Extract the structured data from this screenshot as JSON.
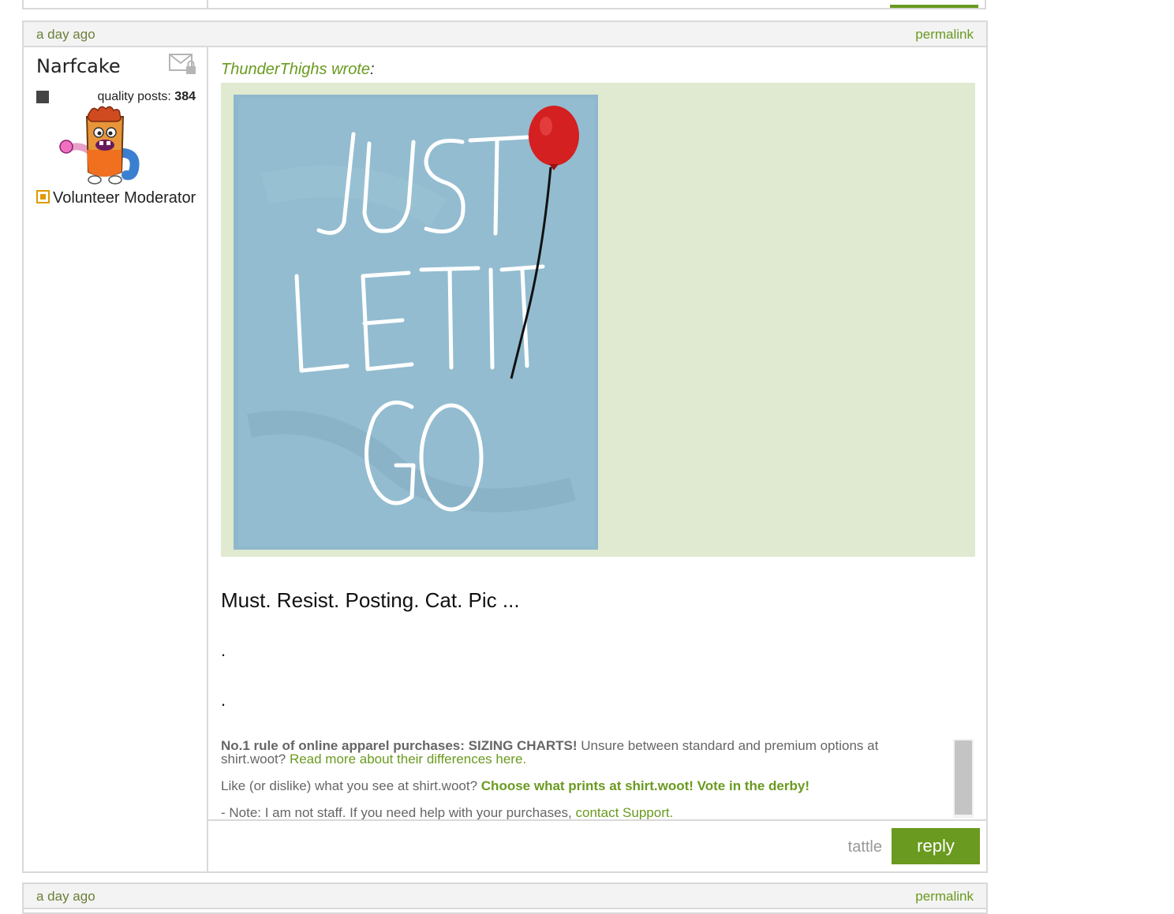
{
  "post": {
    "timestamp": "a day ago",
    "permalink_label": "permalink",
    "author": {
      "name": "Narfcake",
      "quality_posts_label": "quality posts:",
      "quality_posts_count": "384",
      "role": "Volunteer Moderator"
    },
    "quote": {
      "author": "ThunderThighs",
      "wrote_label": "wrote",
      "colon": ":"
    },
    "message": "Must. Resist. Posting. Cat. Pic ...",
    "dot_lines": [
      ".",
      "."
    ],
    "signature": {
      "rule_bold": "No.1 rule of online apparel purchases: SIZING CHARTS!",
      "rule_text": "Unsure between standard and premium options at shirt.woot?",
      "rule_link": "Read more about their differences here.",
      "derby_text": "Like (or dislike) what you see at shirt.woot?",
      "derby_link": "Choose what prints at shirt.woot! Vote in the derby!",
      "note_text": "- Note: I am not staff. If you need help with your purchases,",
      "note_link": "contact Support."
    },
    "actions": {
      "tattle": "tattle",
      "reply": "reply"
    }
  },
  "next_post": {
    "timestamp": "a day ago",
    "permalink_label": "permalink"
  },
  "colors": {
    "accent": "#6a9a1f",
    "quote_background": "#e0ead0",
    "border": "#d9d9d9"
  }
}
